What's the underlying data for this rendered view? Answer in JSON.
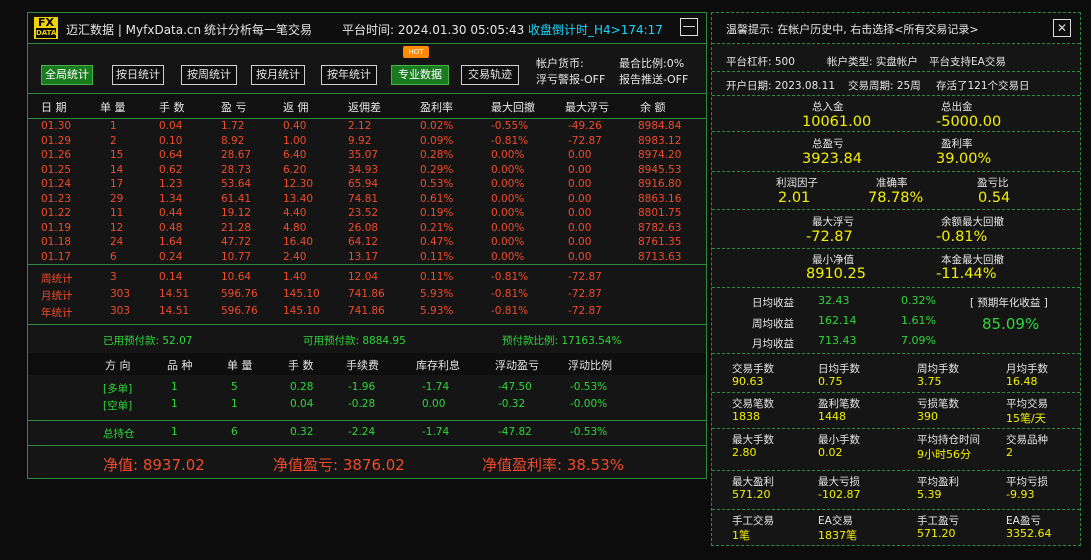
{
  "app": {
    "logo_top": "FX",
    "logo_bottom": "DATA",
    "title": "迈汇数据 | MyfxData.cn",
    "subtitle": "统计分析每一笔交易",
    "platform_time": "平台时间: 2024.01.30 05:05:43",
    "countdown": "收盘倒计时_H4>174:17",
    "minimize": "—"
  },
  "tabs": [
    "全局统计",
    "按日统计",
    "按周统计",
    "按月统计",
    "按年统计",
    "专业数据",
    "交易轨迹"
  ],
  "hot_badge": "HOT",
  "side_info": {
    "currency": "帐户货币:",
    "max_ratio": "最合比例:0%",
    "float_warn": "浮亏警报-OFF",
    "report_push": "报告推送-OFF"
  },
  "table": {
    "headers": [
      "日 期",
      "单 量",
      "手 数",
      "盈 亏",
      "返 佣",
      "返佣差",
      "盈利率",
      "最大回撤",
      "最大浮亏",
      "余 额"
    ],
    "rows": [
      [
        "01.30",
        "1",
        "0.04",
        "1.72",
        "0.40",
        "2.12",
        "0.02%",
        "-0.55%",
        "-49.26",
        "8984.84"
      ],
      [
        "01.29",
        "2",
        "0.10",
        "8.92",
        "1.00",
        "9.92",
        "0.09%",
        "-0.81%",
        "-72.87",
        "8983.12"
      ],
      [
        "01.26",
        "15",
        "0.64",
        "28.67",
        "6.40",
        "35.07",
        "0.28%",
        "0.00%",
        "0.00",
        "8974.20"
      ],
      [
        "01.25",
        "14",
        "0.62",
        "28.73",
        "6.20",
        "34.93",
        "0.29%",
        "0.00%",
        "0.00",
        "8945.53"
      ],
      [
        "01.24",
        "17",
        "1.23",
        "53.64",
        "12.30",
        "65.94",
        "0.53%",
        "0.00%",
        "0.00",
        "8916.80"
      ],
      [
        "01.23",
        "29",
        "1.34",
        "61.41",
        "13.40",
        "74.81",
        "0.61%",
        "0.00%",
        "0.00",
        "8863.16"
      ],
      [
        "01.22",
        "11",
        "0.44",
        "19.12",
        "4.40",
        "23.52",
        "0.19%",
        "0.00%",
        "0.00",
        "8801.75"
      ],
      [
        "01.19",
        "12",
        "0.48",
        "21.28",
        "4.80",
        "26.08",
        "0.21%",
        "0.00%",
        "0.00",
        "8782.63"
      ],
      [
        "01.18",
        "24",
        "1.64",
        "47.72",
        "16.40",
        "64.12",
        "0.47%",
        "0.00%",
        "0.00",
        "8761.35"
      ],
      [
        "01.17",
        "6",
        "0.24",
        "10.77",
        "2.40",
        "13.17",
        "0.11%",
        "0.00%",
        "0.00",
        "8713.63"
      ]
    ],
    "summary": [
      [
        "周统计",
        "3",
        "0.14",
        "10.64",
        "1.40",
        "12.04",
        "0.11%",
        "-0.81%",
        "-72.87",
        ""
      ],
      [
        "月统计",
        "303",
        "14.51",
        "596.76",
        "145.10",
        "741.86",
        "5.93%",
        "-0.81%",
        "-72.87",
        ""
      ],
      [
        "年统计",
        "303",
        "14.51",
        "596.76",
        "145.10",
        "741.86",
        "5.93%",
        "-0.81%",
        "-72.87",
        ""
      ]
    ]
  },
  "margin": {
    "used": "已用预付款: 52.07",
    "available": "可用预付款: 8884.95",
    "ratio": "预付款比例: 17163.54%"
  },
  "positions": {
    "headers": [
      "方 向",
      "品 种",
      "单 量",
      "手 数",
      "手续费",
      "库存利息",
      "浮动盈亏",
      "浮动比例"
    ],
    "rows": [
      [
        "[多单]",
        "1",
        "5",
        "0.28",
        "-1.96",
        "-1.74",
        "-47.50",
        "-0.53%"
      ],
      [
        "[空单]",
        "1",
        "1",
        "0.04",
        "-0.28",
        "0.00",
        "-0.32",
        "-0.00%"
      ]
    ],
    "total": [
      "总持仓",
      "1",
      "6",
      "0.32",
      "-2.24",
      "-1.74",
      "-47.82",
      "-0.53%"
    ]
  },
  "footer": {
    "equity": "净值: 8937.02",
    "equity_pl": "净值盈亏: 3876.02",
    "equity_rate": "净值盈利率: 38.53%"
  },
  "right": {
    "tip": "温馨提示: 在帐户历史中, 右击选择<所有交易记录>",
    "close": "✕",
    "leverage": "平台杠杆: 500",
    "account_type": "帐户类型: 实盘帐户",
    "ea_support": "平台支持EA交易",
    "open_date": "开户日期: 2023.08.11",
    "period": "交易周期: 25周",
    "alive": "存活了121个交易日",
    "deposit_label": "总入金",
    "deposit": "10061.00",
    "withdraw_label": "总出金",
    "withdraw": "-5000.00",
    "profit_label": "总盈亏",
    "profit": "3923.84",
    "profit_rate_label": "盈利率",
    "profit_rate": "39.00%",
    "pf_label": "利润因子",
    "pf": "2.01",
    "accuracy_label": "准确率",
    "accuracy": "78.78%",
    "plr_label": "盈亏比",
    "plr": "0.54",
    "max_float_label": "最大浮亏",
    "max_float": "-72.87",
    "max_dd_label": "余额最大回撤",
    "max_dd": "-0.81%",
    "min_equity_label": "最小净值",
    "min_equity": "8910.25",
    "equity_dd_label": "本金最大回撤",
    "equity_dd": "-11.44%",
    "daily_label": "日均收益",
    "daily": "32.43",
    "daily_pct": "0.32%",
    "weekly_label": "周均收益",
    "weekly": "162.14",
    "weekly_pct": "1.61%",
    "monthly_label": "月均收益",
    "monthly": "713.43",
    "monthly_pct": "7.09%",
    "annual_label": "[ 预期年化收益 ]",
    "annual": "85.09%",
    "grid": [
      [
        [
          "交易手数",
          "90.63"
        ],
        [
          "日均手数",
          "0.75"
        ],
        [
          "周均手数",
          "3.75"
        ],
        [
          "月均手数",
          "16.48"
        ]
      ],
      [
        [
          "交易笔数",
          "1838"
        ],
        [
          "盈利笔数",
          "1448"
        ],
        [
          "亏损笔数",
          "390"
        ],
        [
          "平均交易",
          "15笔/天"
        ]
      ],
      [
        [
          "最大手数",
          "2.80"
        ],
        [
          "最小手数",
          "0.02"
        ],
        [
          "平均持仓时间",
          "9小时56分"
        ],
        [
          "交易品种",
          "2"
        ]
      ],
      [
        [
          "最大盈利",
          "571.20"
        ],
        [
          "最大亏损",
          "-102.87"
        ],
        [
          "平均盈利",
          "5.39"
        ],
        [
          "平均亏损",
          "-9.93"
        ]
      ],
      [
        [
          "手工交易",
          "1笔"
        ],
        [
          "EA交易",
          "1837笔"
        ],
        [
          "手工盈亏",
          "571.20"
        ],
        [
          "EA盈亏",
          "3352.64"
        ]
      ]
    ]
  }
}
